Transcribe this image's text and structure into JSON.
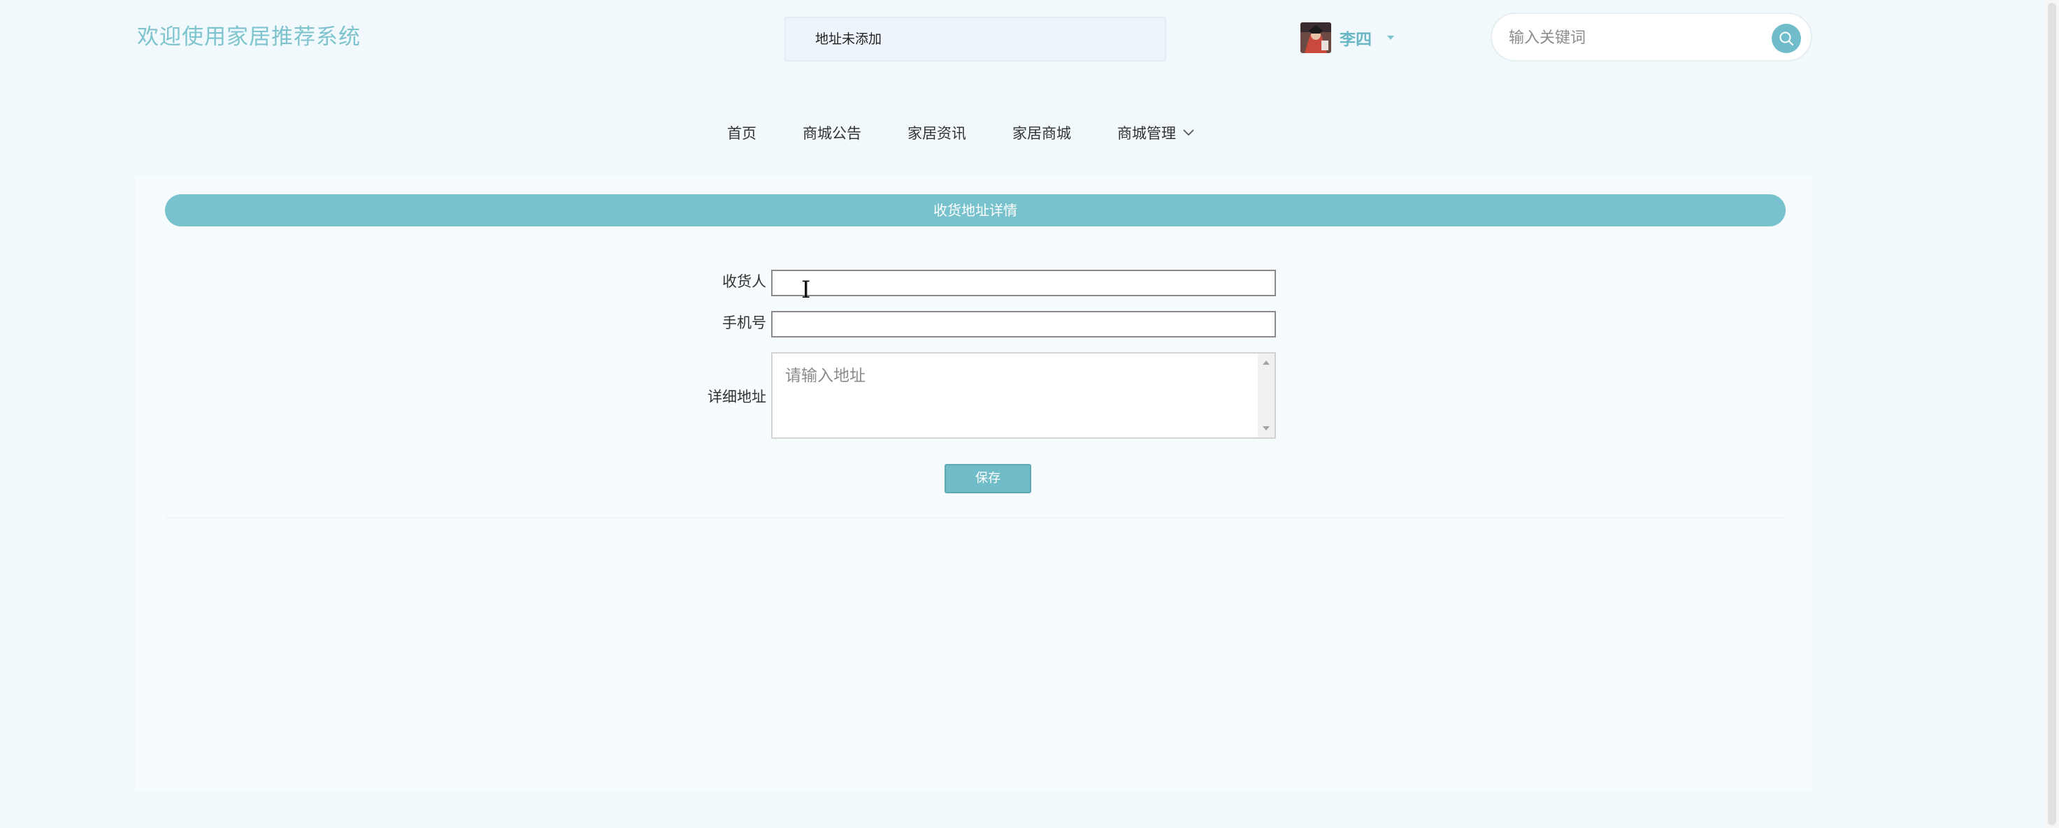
{
  "header": {
    "site_title": "欢迎使用家居推荐系统",
    "address_status": "地址未添加",
    "user": {
      "name": "李四",
      "avatar_icon": "avatar-image"
    },
    "search": {
      "placeholder": "输入关键词",
      "button_icon": "search-icon"
    }
  },
  "nav": {
    "items": [
      {
        "label": "首页"
      },
      {
        "label": "商城公告"
      },
      {
        "label": "家居资讯"
      },
      {
        "label": "家居商城"
      },
      {
        "label": "商城管理",
        "has_dropdown": true
      }
    ]
  },
  "panel": {
    "title": "收货地址详情",
    "form": {
      "receiver_label": "收货人",
      "receiver_value": "",
      "phone_label": "手机号",
      "phone_value": "",
      "address_label": "详细地址",
      "address_placeholder": "请输入地址",
      "address_value": ""
    },
    "save_label": "保存"
  },
  "colors": {
    "accent": "#77c2cd",
    "page_background": "#f1f9fc",
    "title_text": "#7ec4cf"
  }
}
